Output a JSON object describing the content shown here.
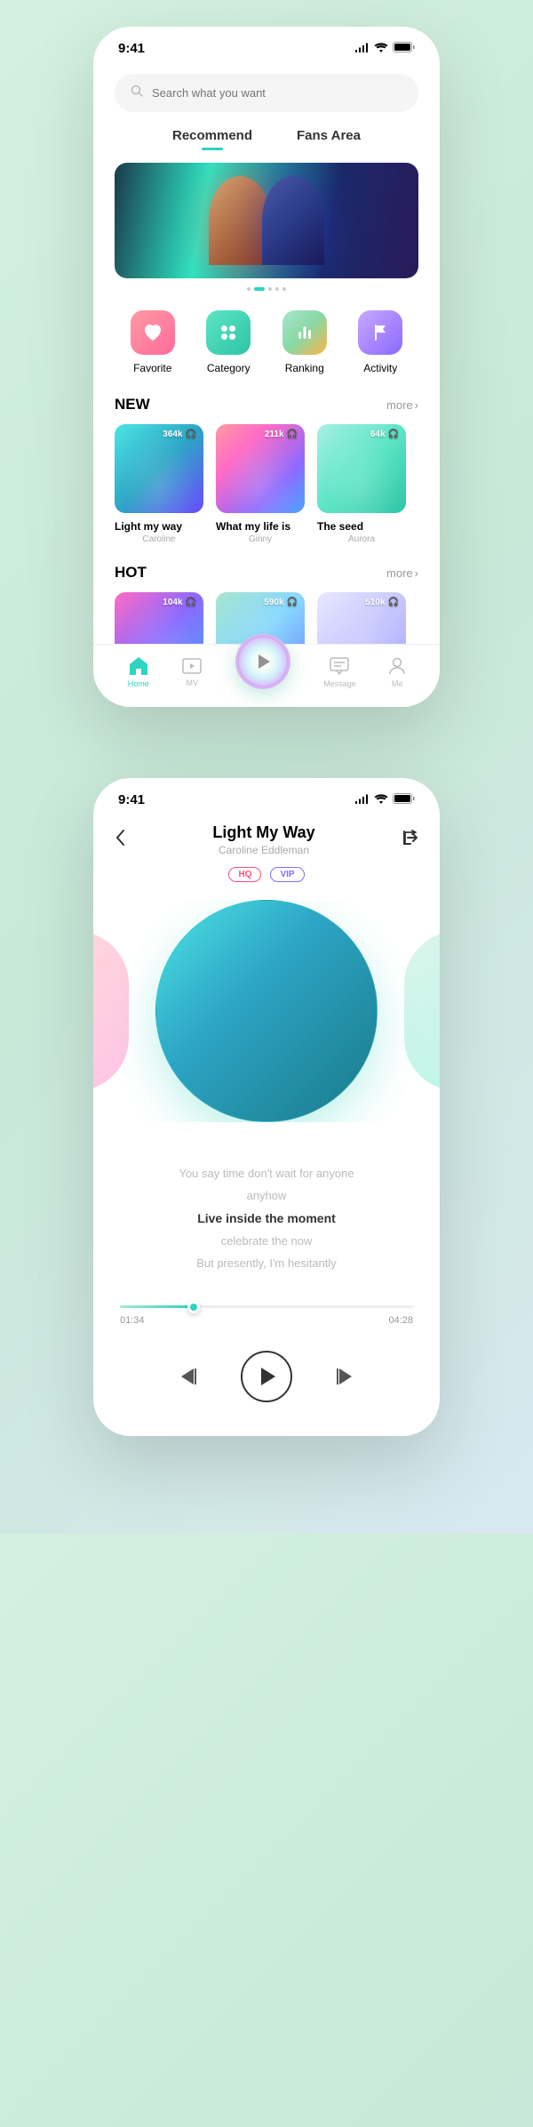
{
  "status": {
    "time": "9:41"
  },
  "search": {
    "placeholder": "Search what you want"
  },
  "tabs": [
    {
      "label": "Recommend",
      "active": true
    },
    {
      "label": "Fans Area",
      "active": false
    }
  ],
  "categories": [
    {
      "label": "Favorite",
      "icon": "heart"
    },
    {
      "label": "Category",
      "icon": "grid"
    },
    {
      "label": "Ranking",
      "icon": "bars"
    },
    {
      "label": "Activity",
      "icon": "flag"
    }
  ],
  "sections": {
    "new": {
      "title": "NEW",
      "more": "more",
      "tracks": [
        {
          "plays": "364k",
          "title": "Light my way",
          "artist": "Caroline"
        },
        {
          "plays": "211k",
          "title": "What my life is",
          "artist": "Ginny"
        },
        {
          "plays": "64k",
          "title": "The seed",
          "artist": "Aurora"
        }
      ]
    },
    "hot": {
      "title": "HOT",
      "more": "more",
      "tracks": [
        {
          "plays": "104k"
        },
        {
          "plays": "590k"
        },
        {
          "plays": "510k"
        }
      ]
    }
  },
  "nav": [
    {
      "label": "Home",
      "icon": "home"
    },
    {
      "label": "MV",
      "icon": "mv"
    },
    {
      "label": "Message",
      "icon": "message"
    },
    {
      "label": "Me",
      "icon": "me"
    }
  ],
  "player": {
    "title": "Light My Way",
    "artist": "Caroline Eddleman",
    "badges": {
      "hq": "HQ",
      "vip": "VIP"
    },
    "lyrics": [
      "You say time don't wait for anyone",
      "anyhow",
      "Live inside the moment",
      "celebrate the now",
      "But presently, I'm hesitantly"
    ],
    "progress": {
      "elapsed": "01:34",
      "total": "04:28"
    }
  }
}
